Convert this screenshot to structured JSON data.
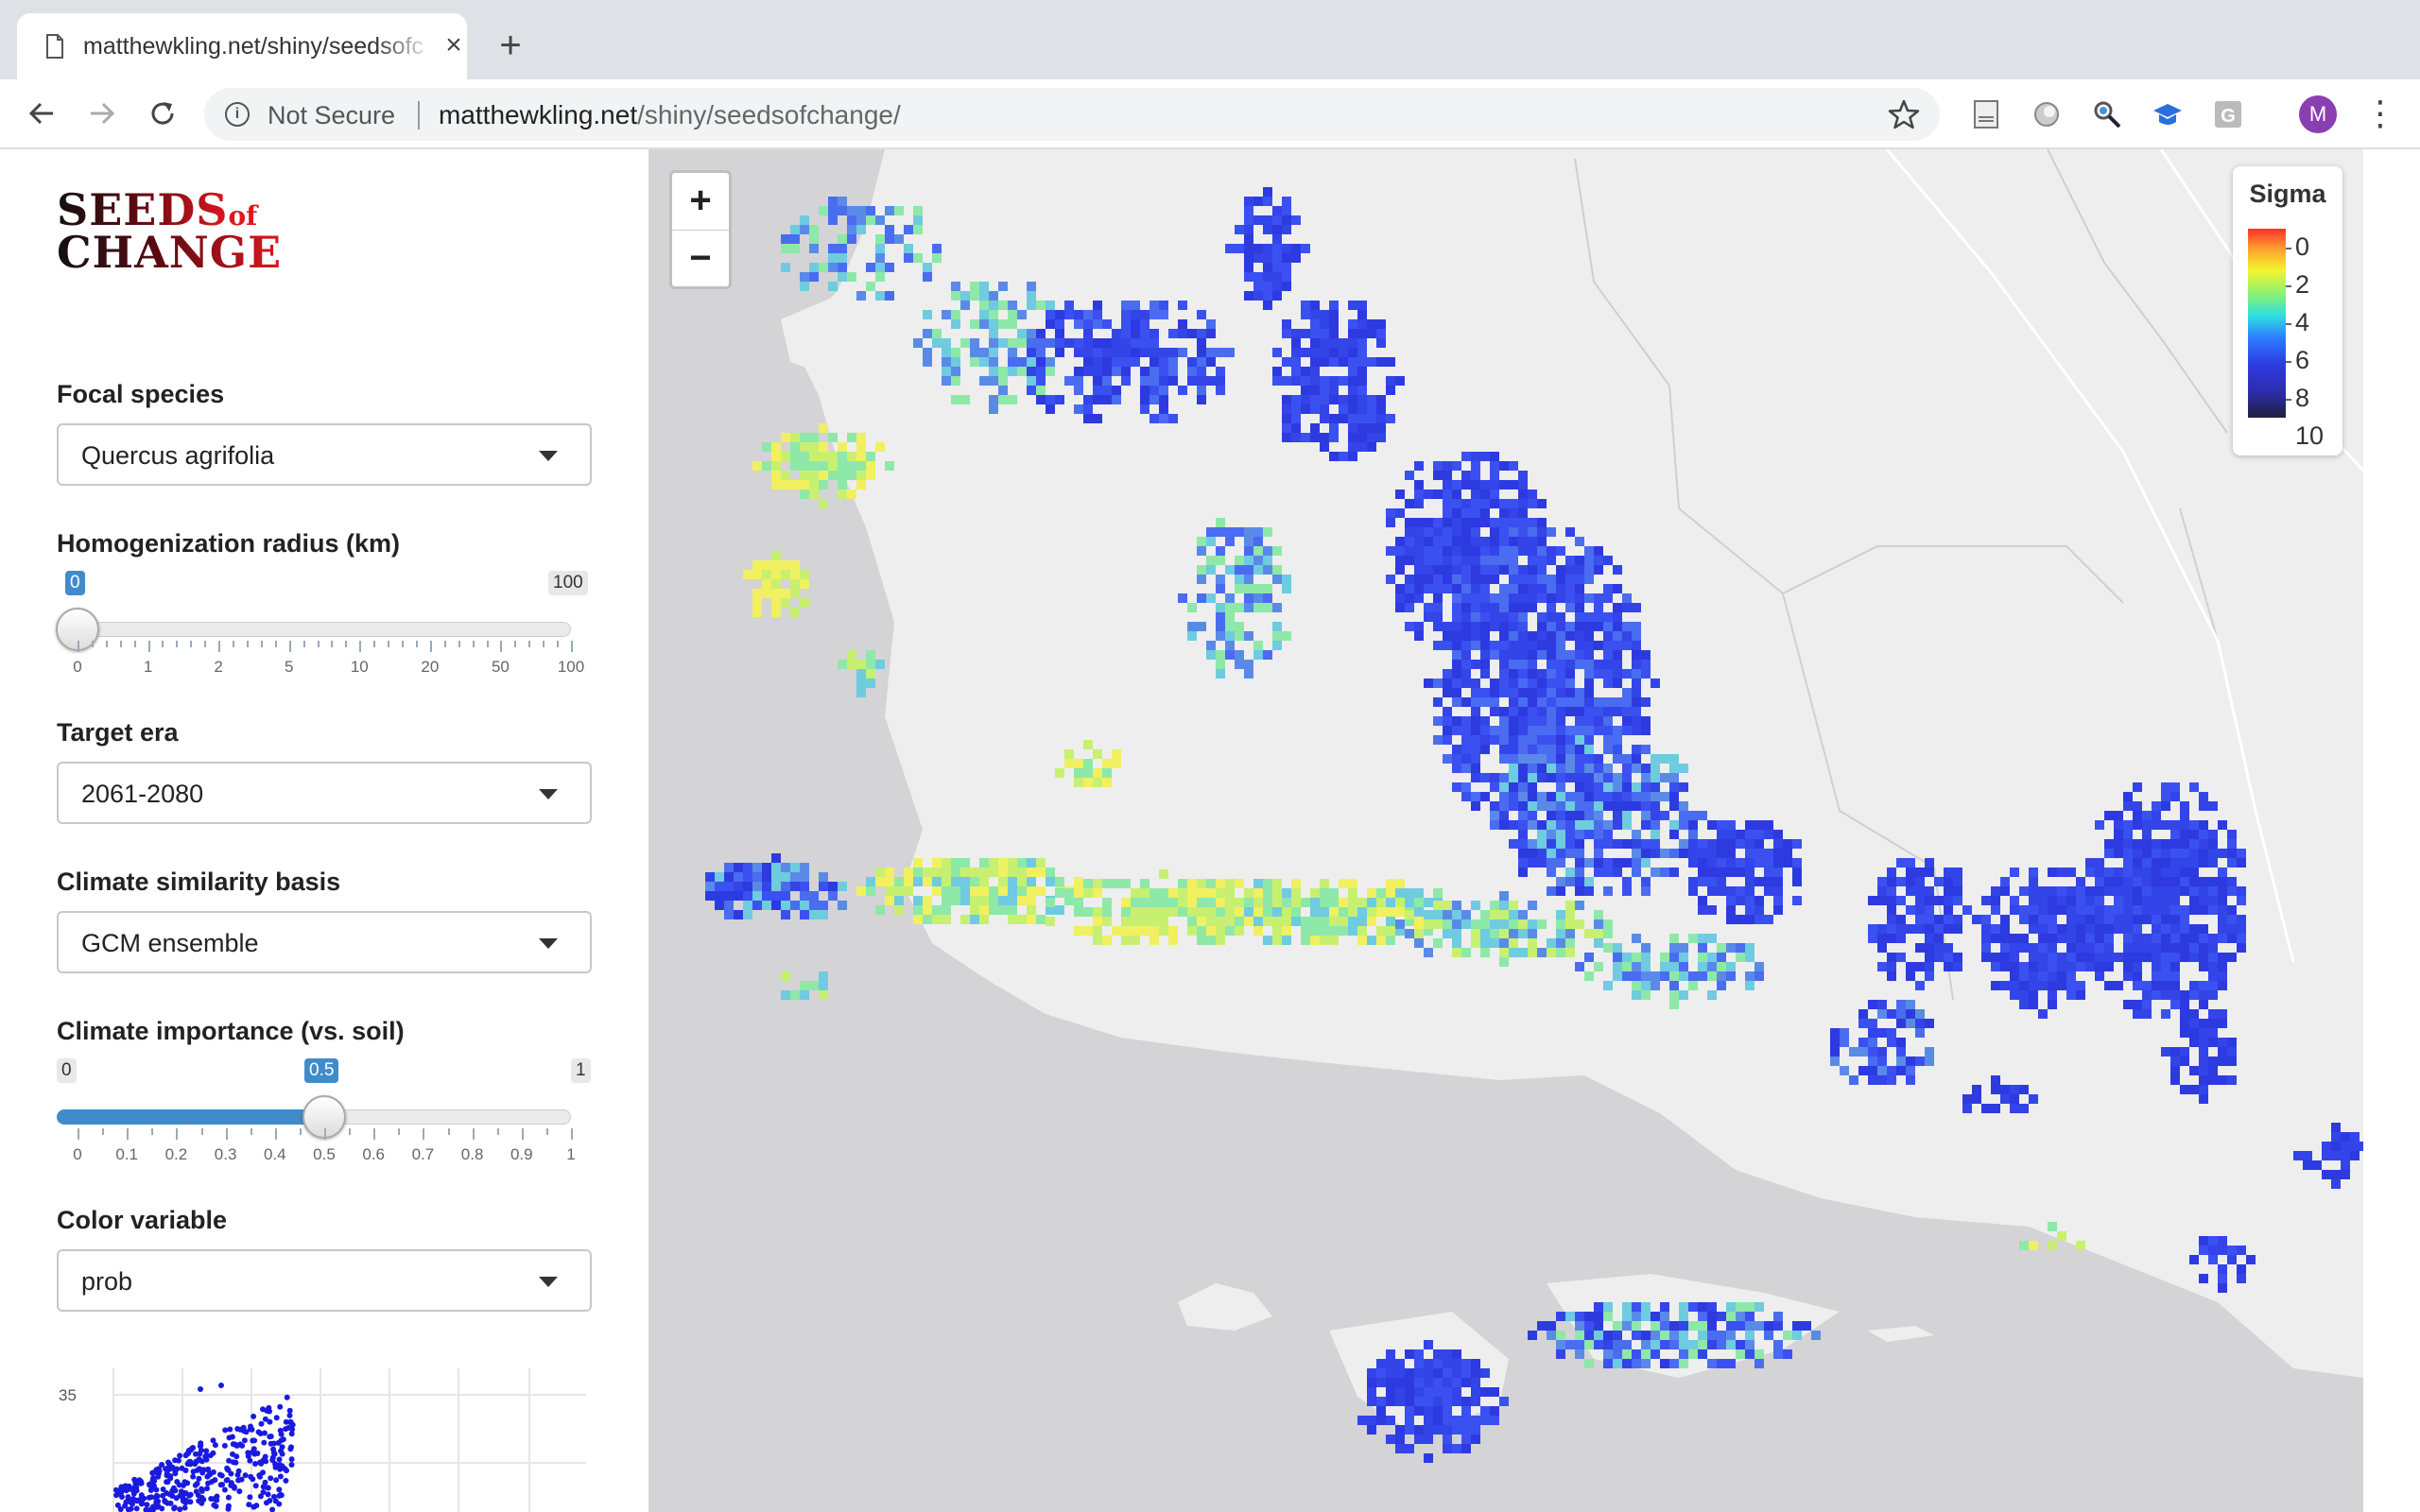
{
  "browser": {
    "tab_title": "matthewkling.net/shiny/seedsofchange/",
    "tab_close": "×",
    "new_tab": "+",
    "security_label": "Not Secure",
    "url_host": "matthewkling.net",
    "url_path": "/shiny/seedsofchange/",
    "avatar_letter": "M",
    "menu": "⋮"
  },
  "sidebar": {
    "logo_line1": "SEEDS",
    "logo_of": "of",
    "logo_line2": "CHANGE",
    "focal_species": {
      "label": "Focal species",
      "value": "Quercus agrifolia"
    },
    "radius": {
      "label": "Homogenization radius (km)",
      "value": "0",
      "max_label": "100",
      "ticks": [
        "0",
        "1",
        "2",
        "5",
        "10",
        "20",
        "50",
        "100"
      ],
      "fraction": 0
    },
    "target_era": {
      "label": "Target era",
      "value": "2061-2080"
    },
    "climate_basis": {
      "label": "Climate similarity basis",
      "value": "GCM ensemble"
    },
    "importance": {
      "label": "Climate importance (vs. soil)",
      "value": "0.5",
      "min_label": "0",
      "max_label": "1",
      "ticks": [
        "0",
        "0.1",
        "0.2",
        "0.3",
        "0.4",
        "0.5",
        "0.6",
        "0.7",
        "0.8",
        "0.9",
        "1"
      ],
      "fraction": 0.5
    },
    "color_variable": {
      "label": "Color variable",
      "value": "prob"
    },
    "scatter_tick": "35"
  },
  "map": {
    "zoom_in": "+",
    "zoom_out": "−",
    "legend": {
      "title": "Sigma",
      "labels": [
        "0",
        "2",
        "4",
        "6",
        "8",
        "10"
      ]
    }
  },
  "icons": {
    "back": "back-arrow-icon",
    "forward": "forward-arrow-icon",
    "reload": "reload-icon",
    "info": "info-icon",
    "star": "bookmark-star-icon",
    "doc": "document-icon"
  },
  "colors": {
    "accent": "#428bca",
    "logo_red": "#e0161f",
    "map_bg": "#d4d4d6",
    "land": "#eeeeee"
  }
}
